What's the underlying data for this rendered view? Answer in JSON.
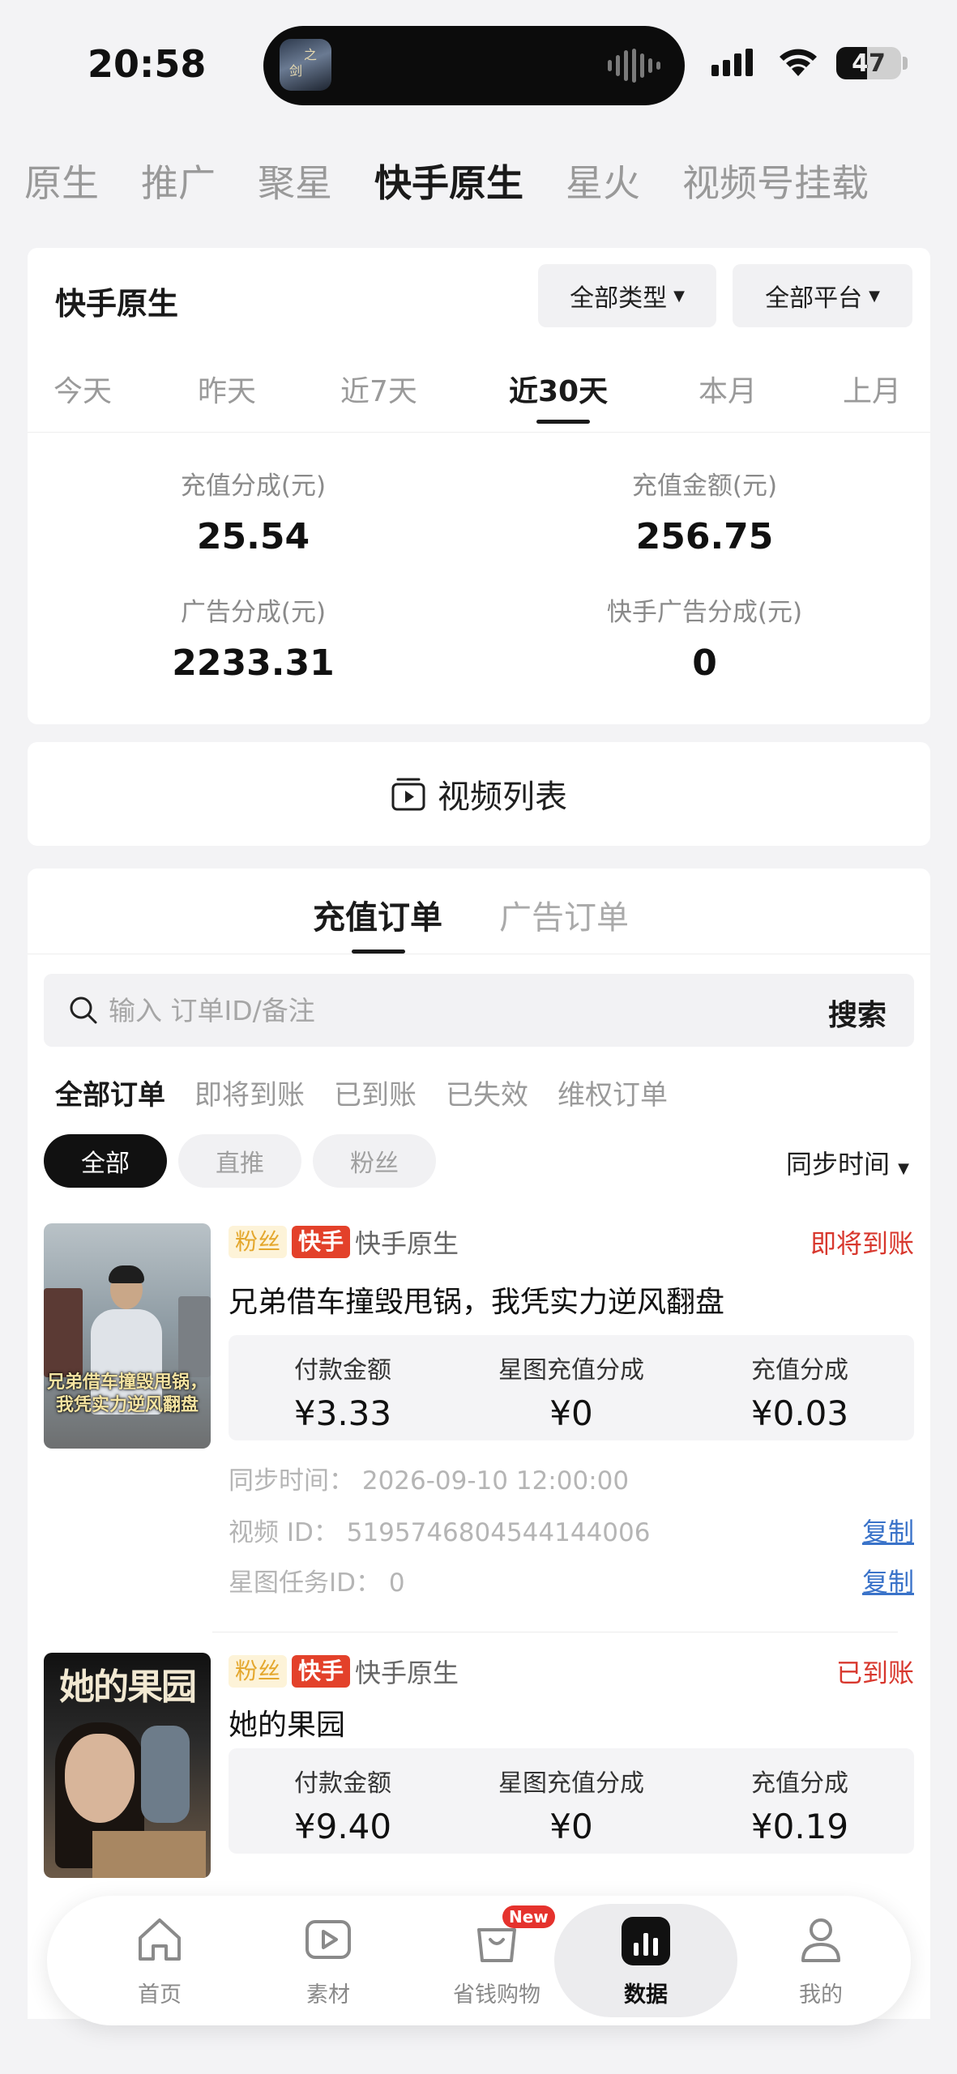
{
  "status_bar": {
    "time": "20:58",
    "battery": "47"
  },
  "top_tabs": [
    {
      "label": "原生",
      "active": false
    },
    {
      "label": "推广",
      "active": false
    },
    {
      "label": "聚星",
      "active": false
    },
    {
      "label": "快手原生",
      "active": true
    },
    {
      "label": "星火",
      "active": false
    },
    {
      "label": "视频号挂载",
      "active": false
    }
  ],
  "summary": {
    "title": "快手原生",
    "type_filter": "全部类型",
    "platform_filter": "全部平台",
    "date_tabs": [
      "今天",
      "昨天",
      "近7天",
      "近30天",
      "本月",
      "上月"
    ],
    "active_date_tab": "近30天",
    "stats": {
      "recharge_share_label": "充值分成(元)",
      "recharge_share_value": "25.54",
      "recharge_amount_label": "充值金额(元)",
      "recharge_amount_value": "256.75",
      "ad_share_label": "广告分成(元)",
      "ad_share_value": "2233.31",
      "ks_ad_share_label": "快手广告分成(元)",
      "ks_ad_share_value": "0"
    }
  },
  "video_list": {
    "label": "视频列表"
  },
  "orders": {
    "tabs": [
      "充值订单",
      "广告订单"
    ],
    "active_tab": "充值订单",
    "search": {
      "placeholder": "输入 订单ID/备注",
      "button": "搜索"
    },
    "status_filters": [
      "全部订单",
      "即将到账",
      "已到账",
      "已失效",
      "维权订单"
    ],
    "active_status_filter": "全部订单",
    "pills": [
      "全部",
      "直推",
      "粉丝"
    ],
    "active_pill": "全部",
    "sort_label": "同步时间",
    "items": [
      {
        "tag_fans": "粉丝",
        "tag_platform": "快手",
        "platform": "快手原生",
        "status": "即将到账",
        "title": "兄弟借车撞毁甩锅，我凭实力逆风翻盘",
        "thumb_caption": "兄弟借车撞毁甩锅，我凭实力逆风翻盘",
        "pay_label": "付款金额",
        "pay_value": "¥3.33",
        "xt_label": "星图充值分成",
        "xt_value": "¥0",
        "share_label": "充值分成",
        "share_value": "¥0.03",
        "sync_time": "同步时间：  2026-09-10 12:00:00",
        "video_id": "视频 ID：  5195746804544144006",
        "task_id": "星图任务ID：  0",
        "copy": "复制"
      },
      {
        "tag_fans": "粉丝",
        "tag_platform": "快手",
        "platform": "快手原生",
        "status": "已到账",
        "title": "她的果园",
        "thumb_title": "她的果园",
        "pay_label": "付款金额",
        "pay_value": "¥9.40",
        "xt_label": "星图充值分成",
        "xt_value": "¥0",
        "share_label": "充值分成",
        "share_value": "¥0.19"
      }
    ]
  },
  "bottom_nav": [
    {
      "label": "首页",
      "icon": "home-icon"
    },
    {
      "label": "素材",
      "icon": "play-icon"
    },
    {
      "label": "省钱购物",
      "icon": "shopping-bag-icon",
      "badge": "New"
    },
    {
      "label": "数据",
      "icon": "bar-chart-icon",
      "active": true
    },
    {
      "label": "我的",
      "icon": "user-icon"
    }
  ],
  "colors": {
    "accent_red": "#d8382e",
    "tag_red": "#e3412a",
    "link_blue": "#3a73c9",
    "tag_gold": "#e4a72d"
  }
}
